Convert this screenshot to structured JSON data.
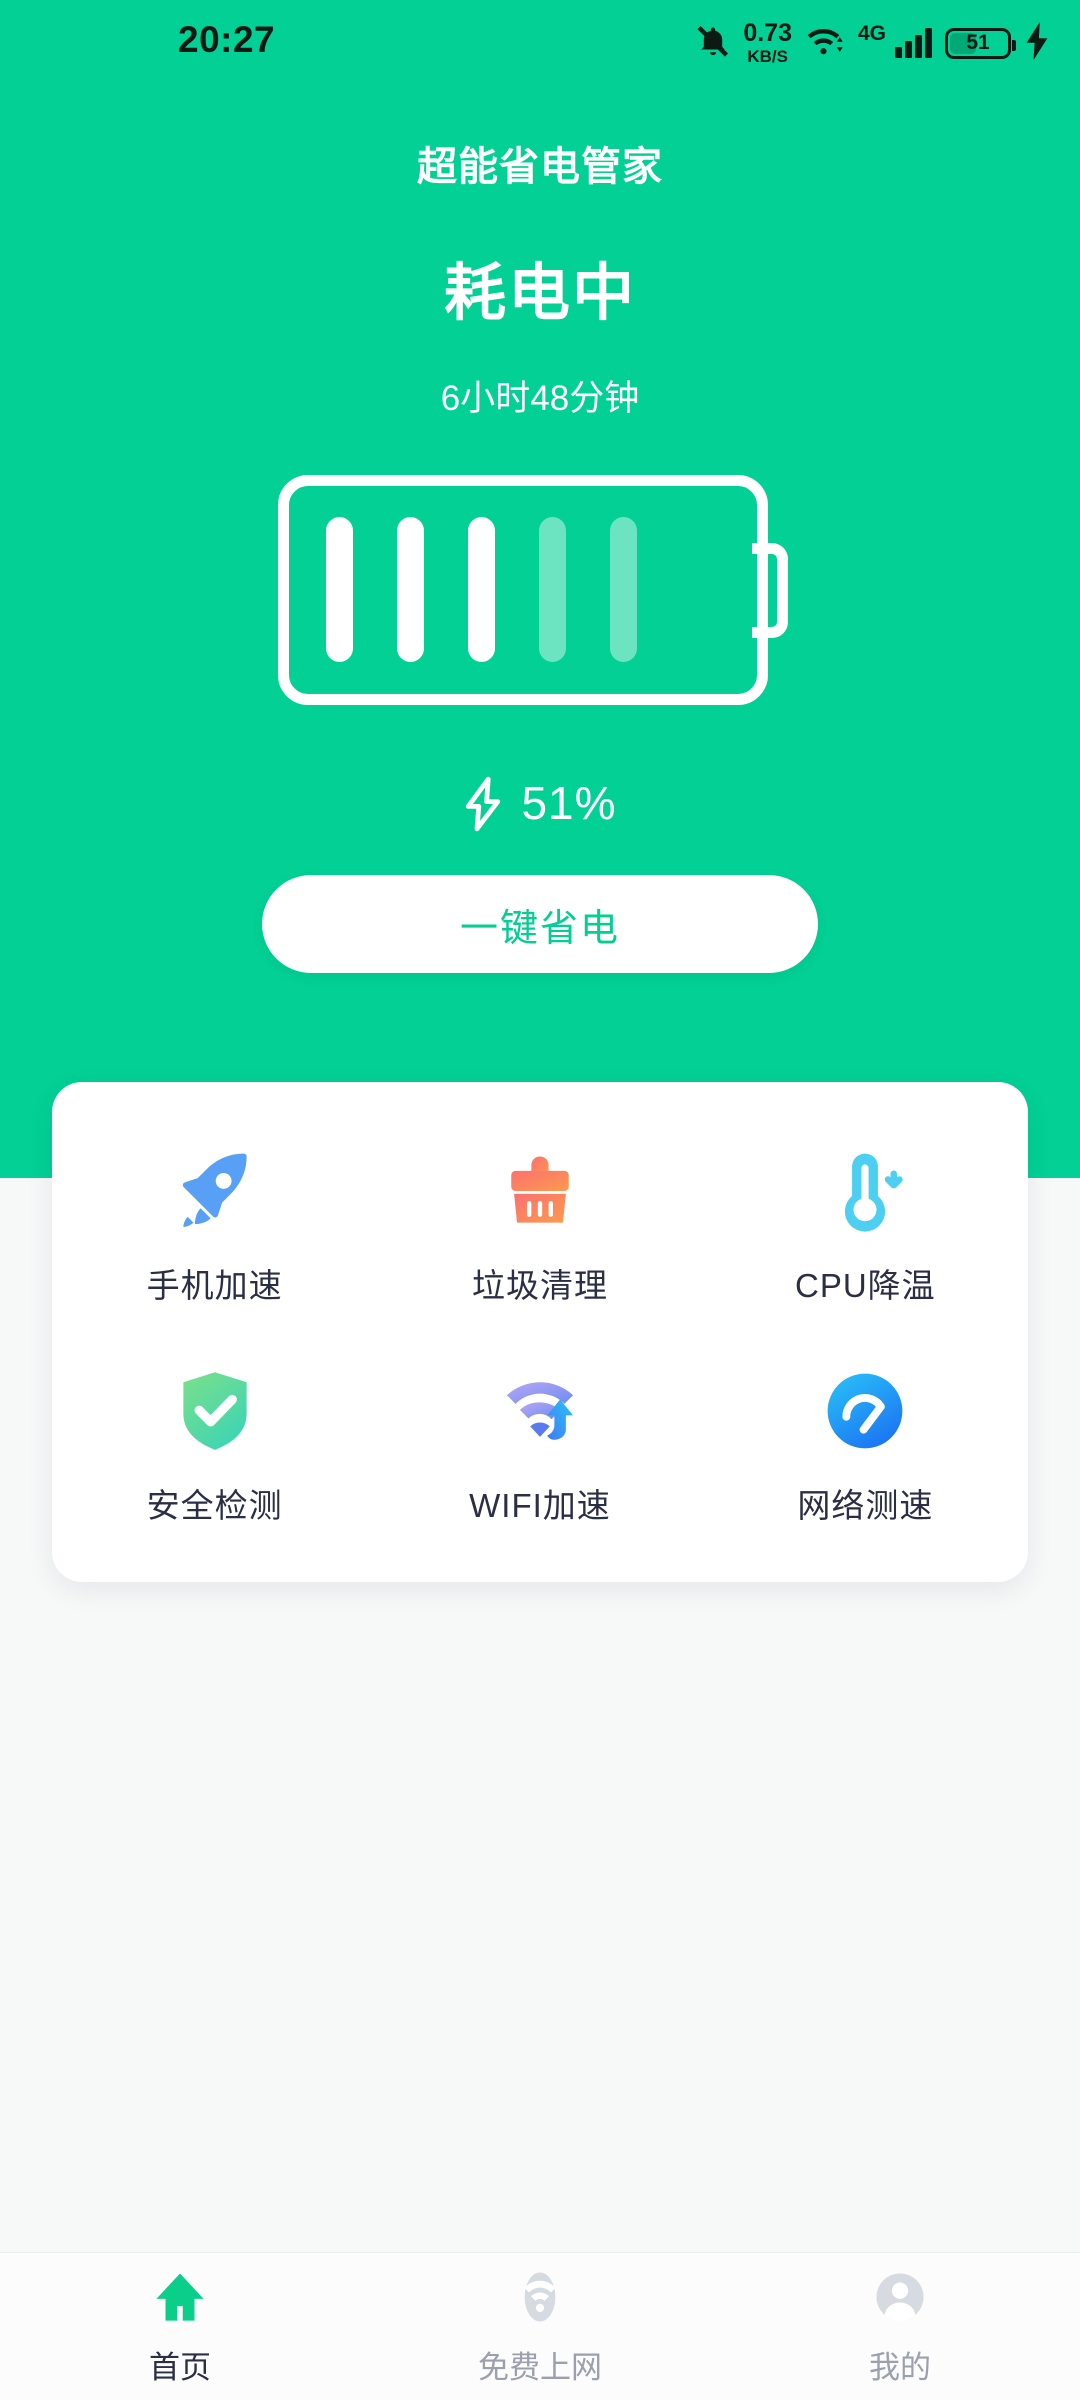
{
  "theme": {
    "brand_green": "#02D094",
    "button_text_green": "#06CE92",
    "page_background": "#F7F8F8",
    "label_dark": "#2B2F45",
    "nav_inactive": "#9AA0AE"
  },
  "status_bar": {
    "time": "20:27",
    "mute_icon": "bell-muted-icon",
    "network_speed_value": "0.73",
    "network_speed_unit": "KB/S",
    "wifi_icon": "wifi-icon",
    "mobile_network": "4G",
    "signal_icon": "signal-bars-icon",
    "battery_level": "51",
    "charging_icon": "lightning-bolt-icon"
  },
  "header": {
    "app_title": "超能省电管家",
    "battery_state": "耗电中",
    "remaining_time": "6小时48分钟",
    "battery_percent": "51%",
    "bolt_icon": "lightning-bolt-icon",
    "battery_icon": "battery-large-icon",
    "battery_bars_total": 5,
    "battery_bars_filled": 3,
    "save_button_label": "一键省电"
  },
  "features": [
    {
      "icon": "rocket-icon",
      "label": "手机加速"
    },
    {
      "icon": "broom-icon",
      "label": "垃圾清理"
    },
    {
      "icon": "thermometer-icon",
      "label": "CPU降温"
    },
    {
      "icon": "shield-check-icon",
      "label": "安全检测"
    },
    {
      "icon": "wifi-boost-icon",
      "label": "WIFI加速"
    },
    {
      "icon": "speedometer-icon",
      "label": "网络测速"
    }
  ],
  "bottom_nav": [
    {
      "icon": "home-icon",
      "label": "首页",
      "active": true
    },
    {
      "icon": "wifi-icon",
      "label": "免费上网",
      "active": false
    },
    {
      "icon": "person-icon",
      "label": "我的",
      "active": false
    }
  ]
}
